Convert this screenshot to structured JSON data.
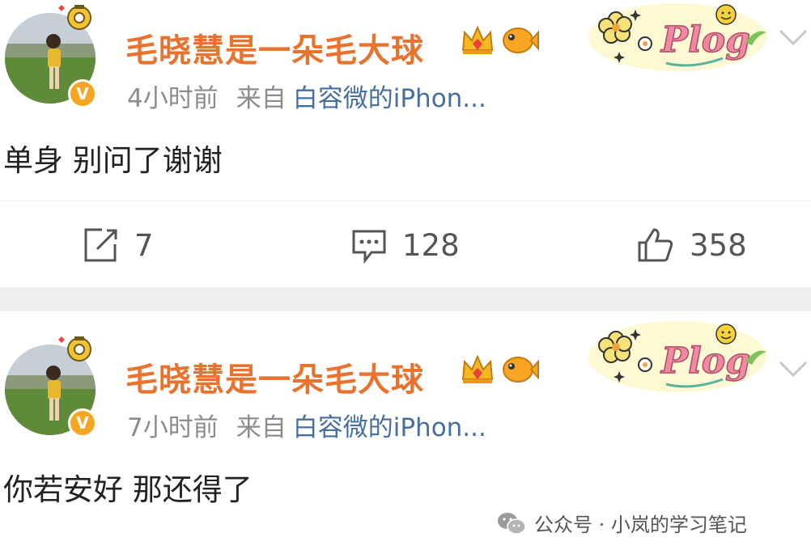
{
  "posts": [
    {
      "username": "毛晓慧是一朵毛大球",
      "time": "4小时前",
      "source_label": "来自",
      "source": "白容微的iPhon...",
      "content": "单身 别问了谢谢",
      "actions": {
        "repost": "7",
        "comment": "128",
        "like": "358"
      },
      "badge": "V"
    },
    {
      "username": "毛晓慧是一朵毛大球",
      "time": "7小时前",
      "source_label": "来自",
      "source": "白容微的iPhon...",
      "content": "你若安好 那还得了",
      "badge": "V"
    }
  ],
  "watermark": "公众号 · 小岚的学习笔记",
  "colors": {
    "username": "#e8732f",
    "source": "#466ea0",
    "meta": "#8c8c8c",
    "badge": "#f6a623"
  },
  "icons": [
    "crown-icon",
    "fish-icon",
    "plog-sticker",
    "chevron-down-icon",
    "repost-icon",
    "comment-icon",
    "like-icon",
    "wechat-icon"
  ]
}
